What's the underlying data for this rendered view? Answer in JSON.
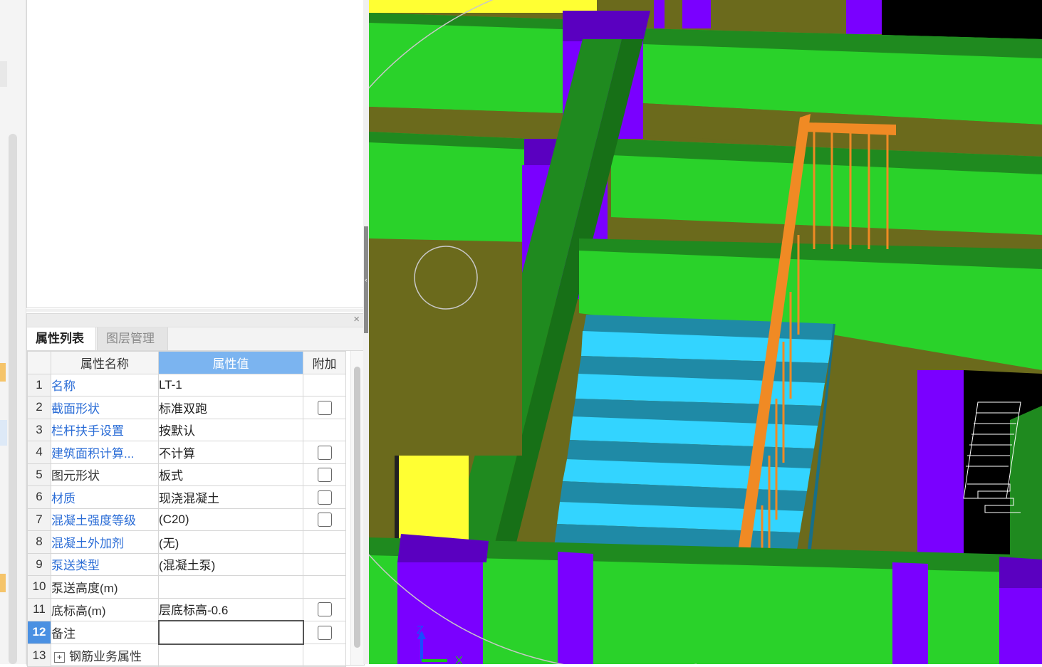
{
  "tabs": {
    "properties": "属性列表",
    "layers": "图层管理"
  },
  "table": {
    "headers": {
      "name": "属性名称",
      "value": "属性值",
      "extra": "附加"
    },
    "rows": [
      {
        "num": "1",
        "name": "名称",
        "value": "LT-1",
        "checkbox": false,
        "blue": true
      },
      {
        "num": "2",
        "name": "截面形状",
        "value": "标准双跑",
        "checkbox": true,
        "blue": true
      },
      {
        "num": "3",
        "name": "栏杆扶手设置",
        "value": "按默认",
        "checkbox": false,
        "blue": true
      },
      {
        "num": "4",
        "name": "建筑面积计算...",
        "value": "不计算",
        "checkbox": true,
        "blue": true
      },
      {
        "num": "5",
        "name": "图元形状",
        "value": "板式",
        "checkbox": true,
        "blue": false
      },
      {
        "num": "6",
        "name": "材质",
        "value": "现浇混凝土",
        "checkbox": true,
        "blue": true
      },
      {
        "num": "7",
        "name": "混凝土强度等级",
        "value": "(C20)",
        "checkbox": true,
        "blue": true
      },
      {
        "num": "8",
        "name": "混凝土外加剂",
        "value": "(无)",
        "checkbox": false,
        "blue": true
      },
      {
        "num": "9",
        "name": "泵送类型",
        "value": "(混凝土泵)",
        "checkbox": false,
        "blue": true
      },
      {
        "num": "10",
        "name": "泵送高度(m)",
        "value": "",
        "checkbox": false,
        "blue": false
      },
      {
        "num": "11",
        "name": "底标高(m)",
        "value": "层底标高-0.6",
        "checkbox": true,
        "blue": false
      },
      {
        "num": "12",
        "name": "备注",
        "value": "",
        "checkbox": true,
        "blue": false,
        "selected": true
      },
      {
        "num": "13",
        "name": "钢筋业务属性",
        "value": "",
        "checkbox": false,
        "blue": false,
        "expandable": true
      }
    ]
  },
  "icons": {
    "close": "close-icon",
    "expand": "plus-expand-icon",
    "axis": "axis-gizmo-icon"
  },
  "colors": {
    "wall": "#2ad22a",
    "column": "#7a00ff",
    "slab": "#6b6a1c",
    "stairs": "#33d4ff",
    "railing": "#f08a24",
    "beam": "#1f8a1f",
    "opening": "#ffff33",
    "void": "#000000"
  },
  "viewport": {
    "axis_labels": {
      "z": "Z",
      "x": "X"
    }
  }
}
